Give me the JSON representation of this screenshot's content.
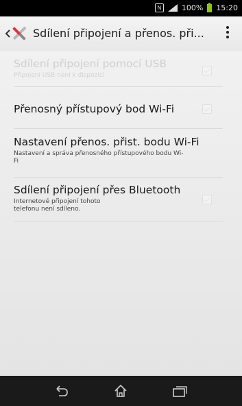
{
  "status_bar": {
    "battery_percent": "100%",
    "time": "15:20",
    "icons": [
      "nfc-icon",
      "signal-icon",
      "battery-icon"
    ]
  },
  "action_bar": {
    "title": "Sdílení připojení a přenos. při...",
    "icons": [
      "back-icon",
      "tools-icon",
      "overflow-menu-icon"
    ]
  },
  "settings": {
    "items": [
      {
        "title": "Sdílení připojení pomocí USB",
        "subtitle": "Připojení USB není k dispozici",
        "enabled": false,
        "has_checkbox": true
      },
      {
        "title": "Přenosný přístupový bod Wi-Fi",
        "subtitle": "",
        "enabled": true,
        "has_checkbox": true
      },
      {
        "title": "Nastavení přenos. přist. bodu Wi-Fi",
        "subtitle": "Nastavení a správa přenosného přístupového bodu Wi-Fi",
        "enabled": true,
        "has_checkbox": false
      },
      {
        "title": "Sdílení připojení přes Bluetooth",
        "subtitle": "Internetové připojení tohoto telefonu není sdíleno.",
        "enabled": true,
        "has_checkbox": true
      }
    ]
  },
  "nav_bar": {
    "icons": [
      "nav-back-icon",
      "nav-home-icon",
      "nav-recent-apps-icon"
    ]
  }
}
